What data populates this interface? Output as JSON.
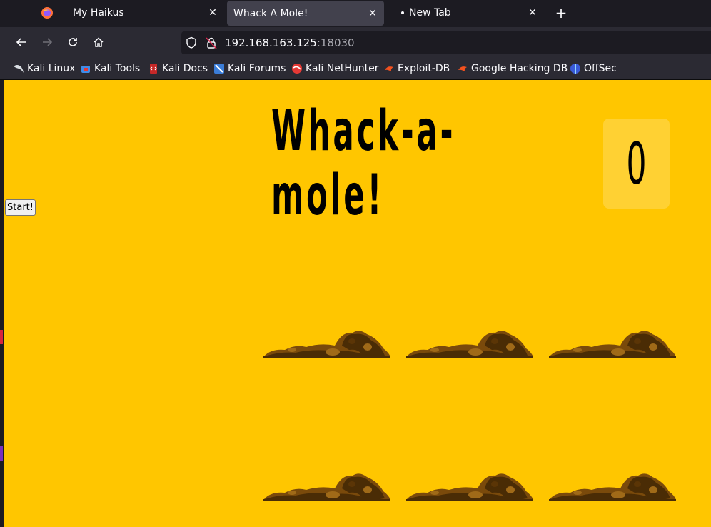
{
  "browser": {
    "tabs": [
      {
        "title": "My Haikus",
        "active": false
      },
      {
        "title": "Whack A Mole!",
        "active": true
      },
      {
        "title": "New Tab",
        "active": false
      }
    ],
    "url_host": "192.168.163.125",
    "url_port": ":18030",
    "bookmarks": [
      {
        "label": "Kali Linux",
        "icon": "kali-dragon-icon"
      },
      {
        "label": "Kali Tools",
        "icon": "kali-tools-icon"
      },
      {
        "label": "Kali Docs",
        "icon": "kali-docs-icon"
      },
      {
        "label": "Kali Forums",
        "icon": "kali-forums-icon"
      },
      {
        "label": "Kali NetHunter",
        "icon": "nethunter-icon"
      },
      {
        "label": "Exploit-DB",
        "icon": "exploit-db-icon"
      },
      {
        "label": "Google Hacking DB",
        "icon": "ghdb-icon"
      },
      {
        "label": "OffSec",
        "icon": "offsec-icon"
      }
    ]
  },
  "game": {
    "start_label": "Start!",
    "title": "Whack-a-mole!",
    "score": "0",
    "holes": 6
  },
  "colors": {
    "background": "#ffc600",
    "dirt_dark": "#4a2c05",
    "dirt_mid": "#7a4a0b",
    "dirt_light": "#a06a18"
  }
}
